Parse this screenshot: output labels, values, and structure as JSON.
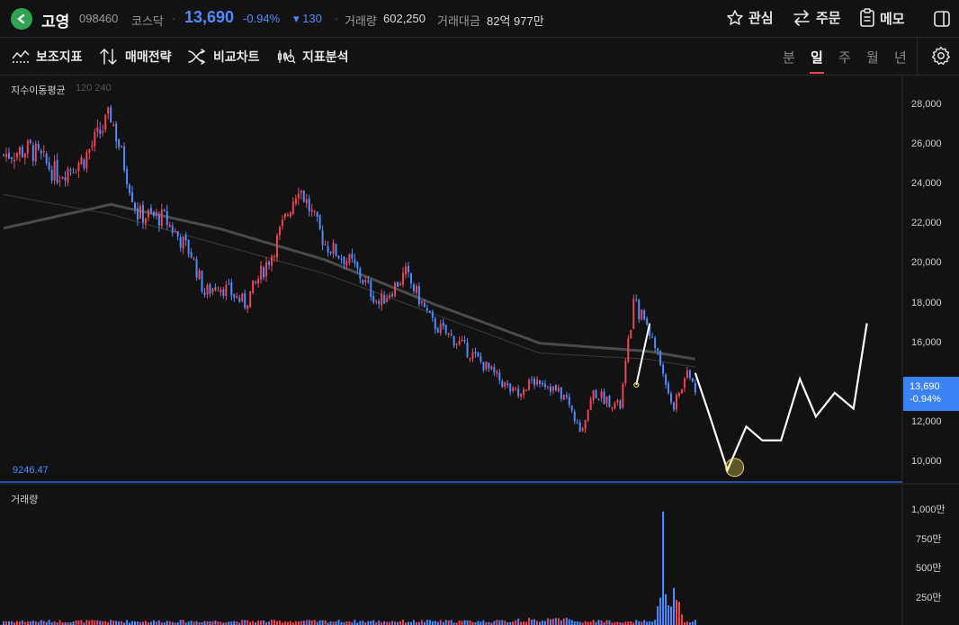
{
  "header": {
    "stock_name": "고영",
    "stock_code": "098460",
    "market": "코스닥",
    "price": "13,690",
    "change_rate": "-0.94%",
    "change_amount": "130",
    "volume_label": "거래량",
    "volume_value": "602,250",
    "amount_label": "거래대금",
    "amount_value": "82억 977만",
    "watch_label": "관심",
    "order_label": "주문",
    "memo_label": "메모"
  },
  "toolbar": {
    "indicator_label": "보조지표",
    "strategy_label": "매매전략",
    "compare_label": "비교차트",
    "analysis_label": "지표분석",
    "periods": [
      "분",
      "일",
      "주",
      "월",
      "년"
    ],
    "active_period": "일"
  },
  "chart_labels": {
    "ma_title": "지수이동평균",
    "ma_values": "120 240",
    "low_line_value": "9246.47",
    "volume_title": "거래량",
    "current_price_tag": "13,690",
    "current_change_tag": "-0.94%"
  },
  "colors": {
    "up": "#f04452",
    "down": "#4d8cff",
    "accent": "#3b82f6",
    "background": "#121212"
  },
  "chart_data": [
    {
      "type": "line",
      "title": "",
      "description_series": [
        {
          "name": "",
          "x_index": [
            0,
            10,
            20,
            30,
            40,
            50,
            60,
            70,
            75,
            80,
            90,
            100,
            110,
            120,
            130,
            140,
            150,
            160,
            170,
            180,
            190,
            200,
            210,
            215,
            220,
            230,
            235,
            240,
            245,
            250,
            255,
            258
          ],
          "values": [
            25500,
            25800,
            24500,
            25300,
            27500,
            22500,
            22300,
            20500,
            18500,
            19000,
            18000,
            20500,
            24000,
            21000,
            20000,
            18000,
            19500,
            17000,
            16000,
            14800,
            13500,
            14200,
            13200,
            11500,
            13500,
            12800,
            18000,
            17000,
            15000,
            12800,
            14500,
            13690
          ]
        }
      ],
      "ma_series": [
        {
          "name": "120",
          "x_index": [
            0,
            40,
            80,
            120,
            160,
            200,
            240,
            258
          ],
          "values": [
            23500,
            22500,
            21000,
            19500,
            17500,
            15500,
            15200,
            14800
          ]
        },
        {
          "name": "240",
          "x_index": [
            0,
            40,
            80,
            120,
            160,
            200,
            240,
            258
          ],
          "values": [
            21800,
            23000,
            21800,
            20200,
            18000,
            16000,
            15600,
            15200
          ]
        }
      ],
      "projection": {
        "x_index": [
          258,
          263,
          270,
          277,
          283,
          290,
          297,
          303,
          310,
          317,
          322
        ],
        "values": [
          14500,
          12500,
          9600,
          11800,
          11100,
          11100,
          14200,
          12300,
          13500,
          12700,
          17000
        ]
      },
      "ylim": [
        9000,
        29500
      ],
      "yticks": [
        "10,000",
        "12,000",
        "14,000",
        "16,000",
        "18,000",
        "20,000",
        "22,000",
        "24,000",
        "26,000",
        "28,000"
      ],
      "ytick_values": [
        10000,
        12000,
        14000,
        16000,
        18000,
        20000,
        22000,
        24000,
        26000,
        28000
      ],
      "hline": 9246.47,
      "grid": false
    },
    {
      "type": "bar",
      "title": "",
      "ylim": [
        0,
        1100
      ],
      "yticks": [
        "250만",
        "500만",
        "750만",
        "1,000만"
      ],
      "ytick_values": [
        250,
        500,
        750,
        1000
      ],
      "spike_index": 246,
      "spike_value": 970
    }
  ]
}
